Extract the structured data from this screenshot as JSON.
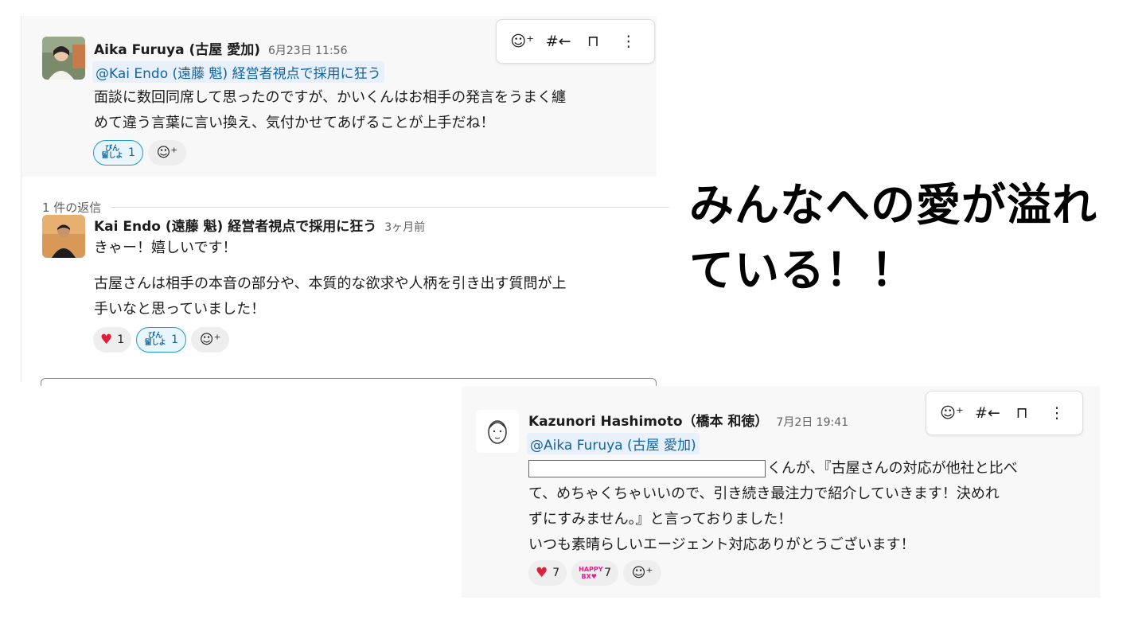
{
  "message1": {
    "author": "Aika Furuya (古屋 愛加)",
    "time": "6月23日 11:56",
    "mention": "@Kai Endo (遠藤 魁) 経営者視点で採用に狂う",
    "line1": "面談に数回同席して思ったのですが、かいくんはお相手の発言をうまく纏",
    "line2": "めて違う言葉に言い換え、気付かせてあげることが上手だね！",
    "reactions": [
      {
        "emoji": "ぴん 留しよ",
        "count": "1"
      }
    ]
  },
  "reply_divider": "1 件の返信",
  "reply": {
    "author": "Kai Endo (遠藤 魁) 経営者視点で採用に狂う",
    "time": "3ヶ月前",
    "line1": "きゃー！嬉しいです！",
    "line2": "古屋さんは相手の本音の部分や、本質的な欲求や人柄を引き出す質問が上",
    "line3": "手いなと思っていました！",
    "reactions": [
      {
        "emoji": "❤️",
        "count": "1"
      },
      {
        "emoji": "ぴん 留しよ",
        "count": "1"
      }
    ]
  },
  "headline": {
    "line1": "みんなへの愛が溢れ",
    "line2": "ている！！"
  },
  "message2": {
    "author": "Kazunori Hashimoto（橋本 和徳）",
    "time": "7月2日 19:41",
    "mention": "@Aika Furuya (古屋 愛加)",
    "line1_suffix": "くんが、『古屋さんの対応が他社と比べ",
    "line2": "て、めちゃくちゃいいので、引き続き最注力で紹介していきます！決めれ",
    "line3": "ずにすみません。』と言っておりました！",
    "line4": "いつも素晴らしいエージェント対応ありがとうございます！",
    "reactions": [
      {
        "emoji": "❤️",
        "count": "7"
      },
      {
        "emoji": "HAPPY BX",
        "count": "7"
      }
    ]
  },
  "colors": {
    "mention_bg": "#e8f0fb",
    "mention_text": "#1264a3",
    "active_reaction_border": "#1d9bd1"
  },
  "icons": [
    "add-reaction-icon",
    "reply-in-thread-icon",
    "bookmark-icon",
    "more-actions-icon"
  ]
}
